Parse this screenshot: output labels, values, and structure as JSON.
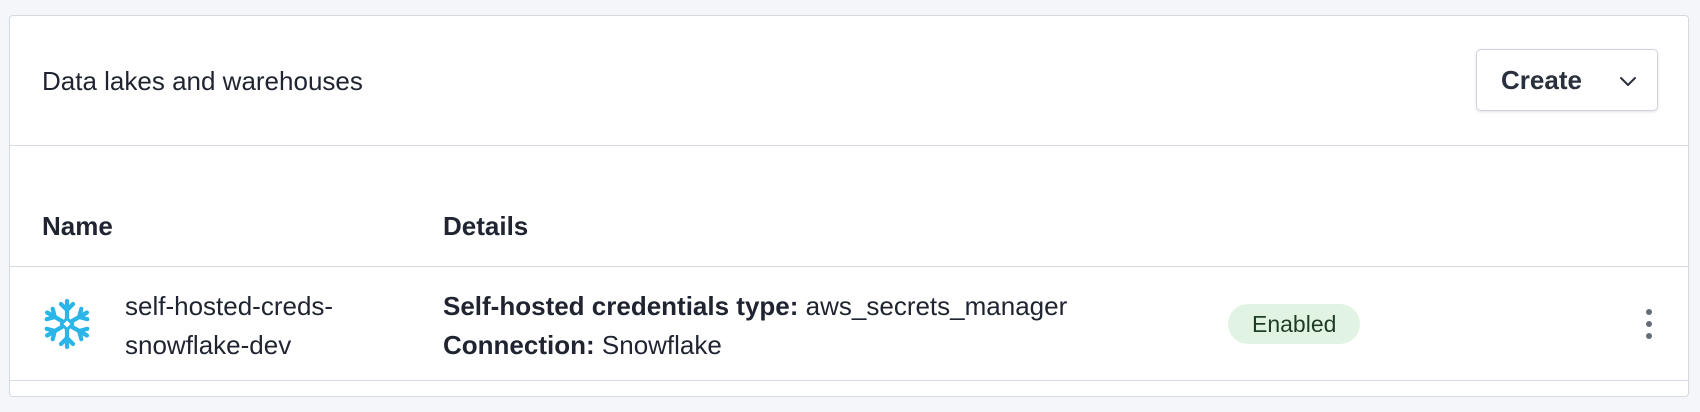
{
  "panel": {
    "title": "Data lakes and warehouses",
    "create_button_label": "Create"
  },
  "table": {
    "columns": [
      "Name",
      "Details"
    ],
    "rows": [
      {
        "name_line1": "self-hosted-creds-",
        "name_line2": "snowflake-dev",
        "icon": "snowflake-icon",
        "detail1_label": "Self-hosted credentials type:",
        "detail1_value": "aws_secrets_manager",
        "detail2_label": "Connection:",
        "detail2_value": "Snowflake",
        "status": "Enabled"
      }
    ]
  },
  "colors": {
    "snowflake_brand": "#29b5e8",
    "status_enabled_bg": "#e1f4e3",
    "border": "#d5dae2"
  }
}
